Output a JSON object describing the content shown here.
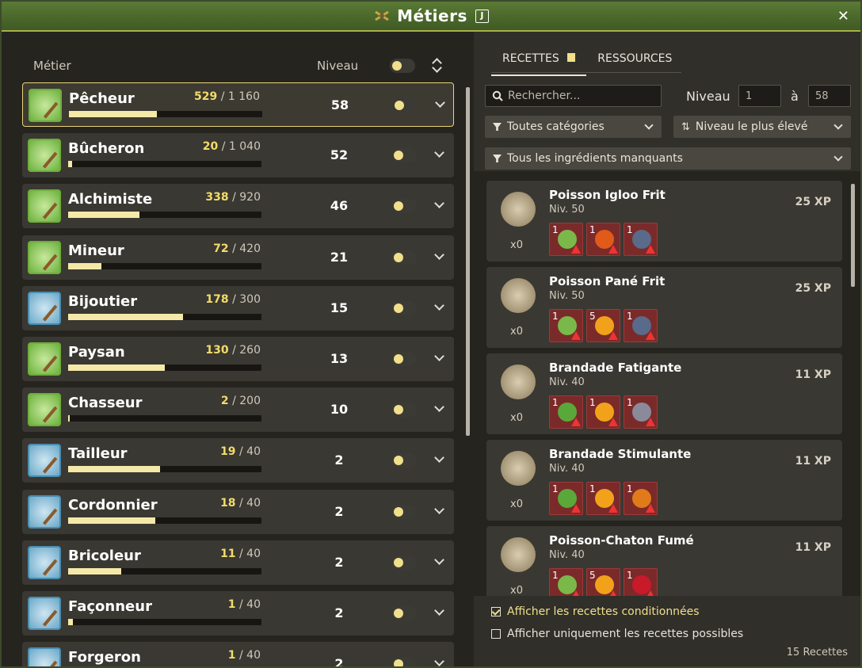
{
  "window": {
    "title": "Métiers",
    "shortcut": "J",
    "close": "✕"
  },
  "left": {
    "header_job": "Métier",
    "header_level": "Niveau",
    "jobs": [
      {
        "name": "Pêcheur",
        "xp": "529",
        "xp_max": "1 160",
        "level": "58",
        "progress": 0.456,
        "selected": true
      },
      {
        "name": "Bûcheron",
        "xp": "20",
        "xp_max": "1 040",
        "level": "52",
        "progress": 0.019
      },
      {
        "name": "Alchimiste",
        "xp": "338",
        "xp_max": "920",
        "level": "46",
        "progress": 0.367
      },
      {
        "name": "Mineur",
        "xp": "72",
        "xp_max": "420",
        "level": "21",
        "progress": 0.171
      },
      {
        "name": "Bijoutier",
        "xp": "178",
        "xp_max": "300",
        "level": "15",
        "progress": 0.593
      },
      {
        "name": "Paysan",
        "xp": "130",
        "xp_max": "260",
        "level": "13",
        "progress": 0.5
      },
      {
        "name": "Chasseur",
        "xp": "2",
        "xp_max": "200",
        "level": "10",
        "progress": 0.01
      },
      {
        "name": "Tailleur",
        "xp": "19",
        "xp_max": "40",
        "level": "2",
        "progress": 0.475
      },
      {
        "name": "Cordonnier",
        "xp": "18",
        "xp_max": "40",
        "level": "2",
        "progress": 0.45
      },
      {
        "name": "Bricoleur",
        "xp": "11",
        "xp_max": "40",
        "level": "2",
        "progress": 0.275
      },
      {
        "name": "Façonneur",
        "xp": "1",
        "xp_max": "40",
        "level": "2",
        "progress": 0.025
      },
      {
        "name": "Forgeron",
        "xp": "1",
        "xp_max": "40",
        "level": "2",
        "progress": 0.025
      }
    ]
  },
  "right": {
    "tabs": {
      "recipes": "RECETTES",
      "resources": "RESSOURCES"
    },
    "search_placeholder": "Rechercher...",
    "level_label": "Niveau",
    "level_from": "1",
    "level_sep": "à",
    "level_to": "58",
    "filter_category": "Toutes catégories",
    "filter_sort": "Niveau le plus élevé",
    "filter_ingredients": "Tous les ingrédients manquants",
    "recipes": [
      {
        "name": "Poisson Igloo Frit",
        "level": "Niv. 50",
        "xp": "25 XP",
        "qty": "x0",
        "ings": [
          {
            "n": "1",
            "color": "#7ab84a"
          },
          {
            "n": "1",
            "color": "#e05a1a"
          },
          {
            "n": "1",
            "color": "#5a6a8a"
          }
        ]
      },
      {
        "name": "Poisson Pané Frit",
        "level": "Niv. 50",
        "xp": "25 XP",
        "qty": "x0",
        "ings": [
          {
            "n": "1",
            "color": "#7ab84a"
          },
          {
            "n": "5",
            "color": "#f2a21a"
          },
          {
            "n": "1",
            "color": "#5a6a8a"
          }
        ]
      },
      {
        "name": "Brandade Fatigante",
        "level": "Niv. 40",
        "xp": "11 XP",
        "qty": "x0",
        "ings": [
          {
            "n": "1",
            "color": "#5aa83a"
          },
          {
            "n": "1",
            "color": "#f2a21a"
          },
          {
            "n": "1",
            "color": "#8a8a9a"
          }
        ]
      },
      {
        "name": "Brandade Stimulante",
        "level": "Niv. 40",
        "xp": "11 XP",
        "qty": "x0",
        "ings": [
          {
            "n": "1",
            "color": "#5aa83a"
          },
          {
            "n": "1",
            "color": "#f2a21a"
          },
          {
            "n": "1",
            "color": "#e07a1a"
          }
        ]
      },
      {
        "name": "Poisson-Chaton Fumé",
        "level": "Niv. 40",
        "xp": "11 XP",
        "qty": "x0",
        "ings": [
          {
            "n": "1",
            "color": "#7ab84a"
          },
          {
            "n": "5",
            "color": "#f2a21a"
          },
          {
            "n": "1",
            "color": "#c81a2a"
          }
        ]
      }
    ],
    "check_conditional": "Afficher les recettes conditionnées",
    "check_possible": "Afficher uniquement les recettes possibles",
    "count": "15 Recettes"
  }
}
